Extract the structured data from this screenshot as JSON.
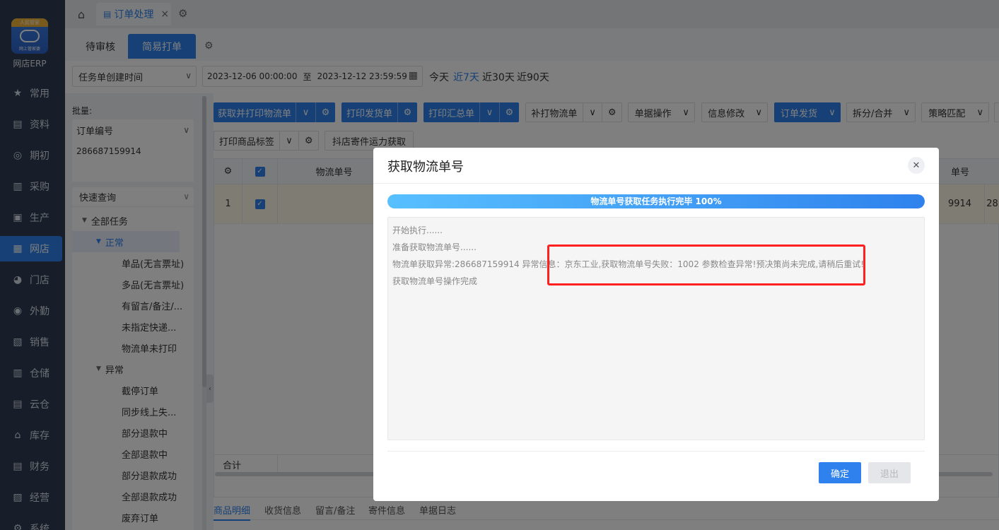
{
  "app": {
    "logo_top": "人民管家",
    "logo_sub": "网上管家婆",
    "logo_text": "网店ERP"
  },
  "nav": [
    {
      "label": "常用",
      "icon": "star-icon",
      "glyph": "★"
    },
    {
      "label": "资料",
      "icon": "document-icon",
      "glyph": "▤"
    },
    {
      "label": "期初",
      "icon": "target-icon",
      "glyph": "◎"
    },
    {
      "label": "采购",
      "icon": "purchase-icon",
      "glyph": "▥"
    },
    {
      "label": "生产",
      "icon": "production-icon",
      "glyph": "▣"
    },
    {
      "label": "网店",
      "icon": "store-icon",
      "glyph": "▦",
      "active": true
    },
    {
      "label": "门店",
      "icon": "pie-icon",
      "glyph": "◕"
    },
    {
      "label": "外勤",
      "icon": "field-icon",
      "glyph": "◉"
    },
    {
      "label": "销售",
      "icon": "sales-icon",
      "glyph": "▧"
    },
    {
      "label": "仓储",
      "icon": "warehouse-icon",
      "glyph": "▥"
    },
    {
      "label": "云仓",
      "icon": "cloud-warehouse-icon",
      "glyph": "▤"
    },
    {
      "label": "库存",
      "icon": "inventory-icon",
      "glyph": "⌂"
    },
    {
      "label": "财务",
      "icon": "finance-icon",
      "glyph": "▤"
    },
    {
      "label": "经营",
      "icon": "business-icon",
      "glyph": "▨"
    },
    {
      "label": "系统",
      "icon": "system-icon",
      "glyph": "⚙"
    }
  ],
  "topbar": {
    "tab_label": "订单处理",
    "close": "×"
  },
  "subtabs": [
    "待审核",
    "简易打单"
  ],
  "filter": {
    "time_type": "任务单创建时间",
    "date_from": "2023-12-06 00:00:00",
    "date_to_sep": "至",
    "date_to": "2023-12-12 23:59:59",
    "quick": [
      "今天",
      "近7天",
      "近30天",
      "近90天"
    ],
    "quick_active": 1
  },
  "batch": {
    "label": "批量:",
    "field": "订单编号",
    "value": "286687159914"
  },
  "tree": {
    "head": "快速查询",
    "items": [
      {
        "label": "全部任务",
        "level": 0,
        "tri": "▼"
      },
      {
        "label": "正常",
        "level": 1,
        "tri": "▼",
        "selected": true
      },
      {
        "label": "单品(无言票址)",
        "level": 2
      },
      {
        "label": "多品(无言票址)",
        "level": 2
      },
      {
        "label": "有留言/备注/...",
        "level": 2
      },
      {
        "label": "未指定快递...",
        "level": 2
      },
      {
        "label": "物流单未打印",
        "level": 2
      },
      {
        "label": "异常",
        "level": 1,
        "tri": "▼"
      },
      {
        "label": "截停订单",
        "level": 2
      },
      {
        "label": "同步线上失...",
        "level": 2
      },
      {
        "label": "部分退款中",
        "level": 2
      },
      {
        "label": "全部退款中",
        "level": 2
      },
      {
        "label": "部分退款成功",
        "level": 2
      },
      {
        "label": "全部退款成功",
        "level": 2
      },
      {
        "label": "废弃订单",
        "level": 2
      }
    ]
  },
  "toolbar": {
    "get_print": "获取并打印物流单",
    "print_invoice": "打印发货单",
    "print_summary": "打印汇总单",
    "reprint": "补打物流单",
    "doc_ops": "单据操作",
    "info_edit": "信息修改",
    "ship": "订单发货",
    "split_merge": "拆分/合并",
    "strategy": "策略匹配",
    "print_label": "打印商品标签",
    "douyin": "抖店寄件运力获取"
  },
  "grid": {
    "col_logistics": "物流单号",
    "col_right": "单号",
    "row_index": "1",
    "row_right_a": "9914",
    "row_right_b": "28",
    "footer": "合计"
  },
  "bottom_tabs": [
    "商品明细",
    "收货信息",
    "留言/备注",
    "寄件信息",
    "单据日志"
  ],
  "modal": {
    "title": "获取物流单号",
    "progress_text": "物流单号获取任务执行完毕 100%",
    "progress": 1.0,
    "log": [
      "开始执行......",
      "准备获取物流单号......",
      "物流单获取异常:286687159914 异常信息：京东工业,获取物流单号失败：1002 参数检查异常!预决策尚未完成,请稍后重试!",
      "获取物流单号操作完成"
    ],
    "ok": "确定",
    "exit": "退出"
  }
}
